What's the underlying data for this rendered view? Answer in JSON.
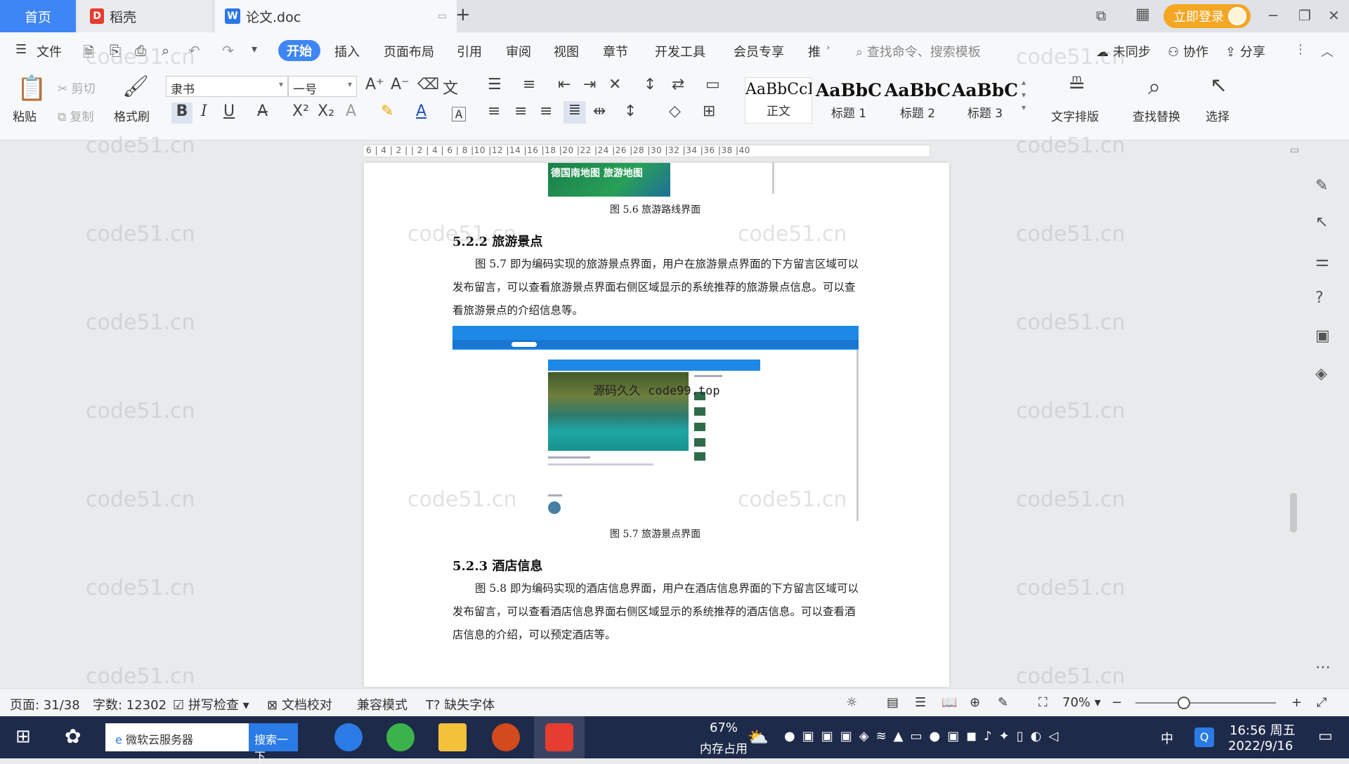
{
  "tabs": {
    "home": "首页",
    "daoke": "稻壳",
    "doc": "论文.doc",
    "add": "+",
    "login": "立即登录"
  },
  "menu": {
    "file": "文件",
    "items": [
      "开始",
      "插入",
      "页面布局",
      "引用",
      "审阅",
      "视图",
      "章节",
      "开发工具",
      "会员专享",
      "推"
    ],
    "search_cmd": "查找命令、搜索模板",
    "sync": "未同步",
    "collab": "协作",
    "share": "分享"
  },
  "ribbon": {
    "paste": "粘贴",
    "cut": "剪切",
    "copy": "复制",
    "format_painter": "格式刷",
    "font_name": "隶书",
    "font_size": "一号",
    "styles": [
      {
        "preview": "AaBbCcI",
        "label": "正文"
      },
      {
        "preview": "AaBbC",
        "label": "标题 1"
      },
      {
        "preview": "AaBbC",
        "label": "标题 2"
      },
      {
        "preview": "AaBbC",
        "label": "标题 3"
      }
    ],
    "text_layout": "文字排版",
    "find_replace": "查找替换",
    "select": "选择"
  },
  "ruler": "6 | 4 | 2 |   | 2 | 4 | 6 | 8 |10 |12 |14 |16 |18 |20 |22 |24 |26 |28 |30 |32 |34 |36 |38 |40",
  "document": {
    "fig56_caption": "图 5.6  旅游路线界面",
    "fig56_img_text": "德国南地图 旅游地图",
    "h522": "5.2.2  旅游景点",
    "p522": "图 5.7 即为编码实现的旅游景点界面，用户在旅游景点界面的下方留言区域可以发布留言，可以查看旅游景点界面右侧区域显示的系统推荐的旅游景点信息。可以查看旅游景点的介绍信息等。",
    "overlay": "源码久久 code99.top",
    "fig57_caption": "图 5.7  旅游景点界面",
    "h523": "5.2.3  酒店信息",
    "p523": "图 5.8 即为编码实现的酒店信息界面，用户在酒店信息界面的下方留言区域可以发布留言，可以查看酒店信息界面右侧区域显示的系统推荐的酒店信息。可以查看酒店信息的介绍，可以预定酒店等。"
  },
  "watermark": "code51.cn",
  "status": {
    "page": "页面: 31/38",
    "words": "字数: 12302",
    "spell": "拼写检查",
    "proof": "文档校对",
    "compat": "兼容模式",
    "missing_font": "缺失字体",
    "zoom": "70%"
  },
  "taskbar": {
    "search_text": "微软云服务器",
    "search_btn": "搜索一下",
    "mem_pct": "67%",
    "mem_label": "内存占用",
    "ime": "中",
    "time": "16:56 周五",
    "date": "2022/9/16"
  }
}
